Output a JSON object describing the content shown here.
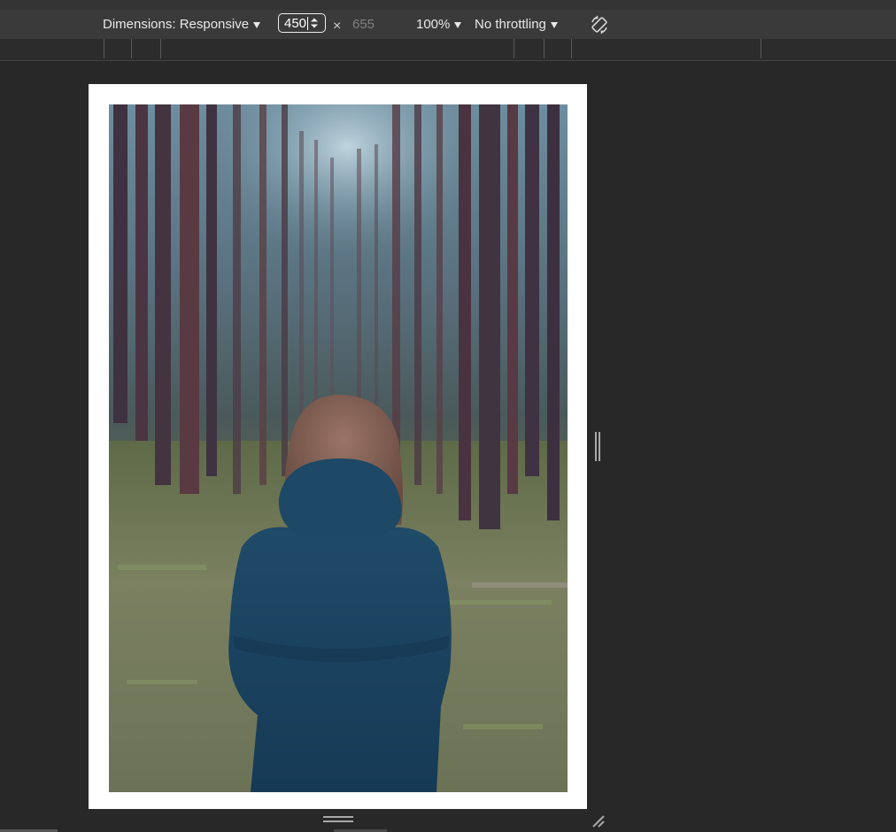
{
  "toolbar": {
    "dimensions_label": "Dimensions: Responsive",
    "width_value": "450",
    "times_symbol": "×",
    "height_value": "655",
    "zoom_label": "100%",
    "throttling_label": "No throttling",
    "rotate_icon": "rotate-device-icon"
  },
  "viewport": {
    "image_subject": "forest-person-photo"
  },
  "colors": {
    "canvas_bg": "#282828",
    "toolbar_bg": "#3a3a3a",
    "text": "#e8e8e8",
    "muted_text": "#808080"
  }
}
